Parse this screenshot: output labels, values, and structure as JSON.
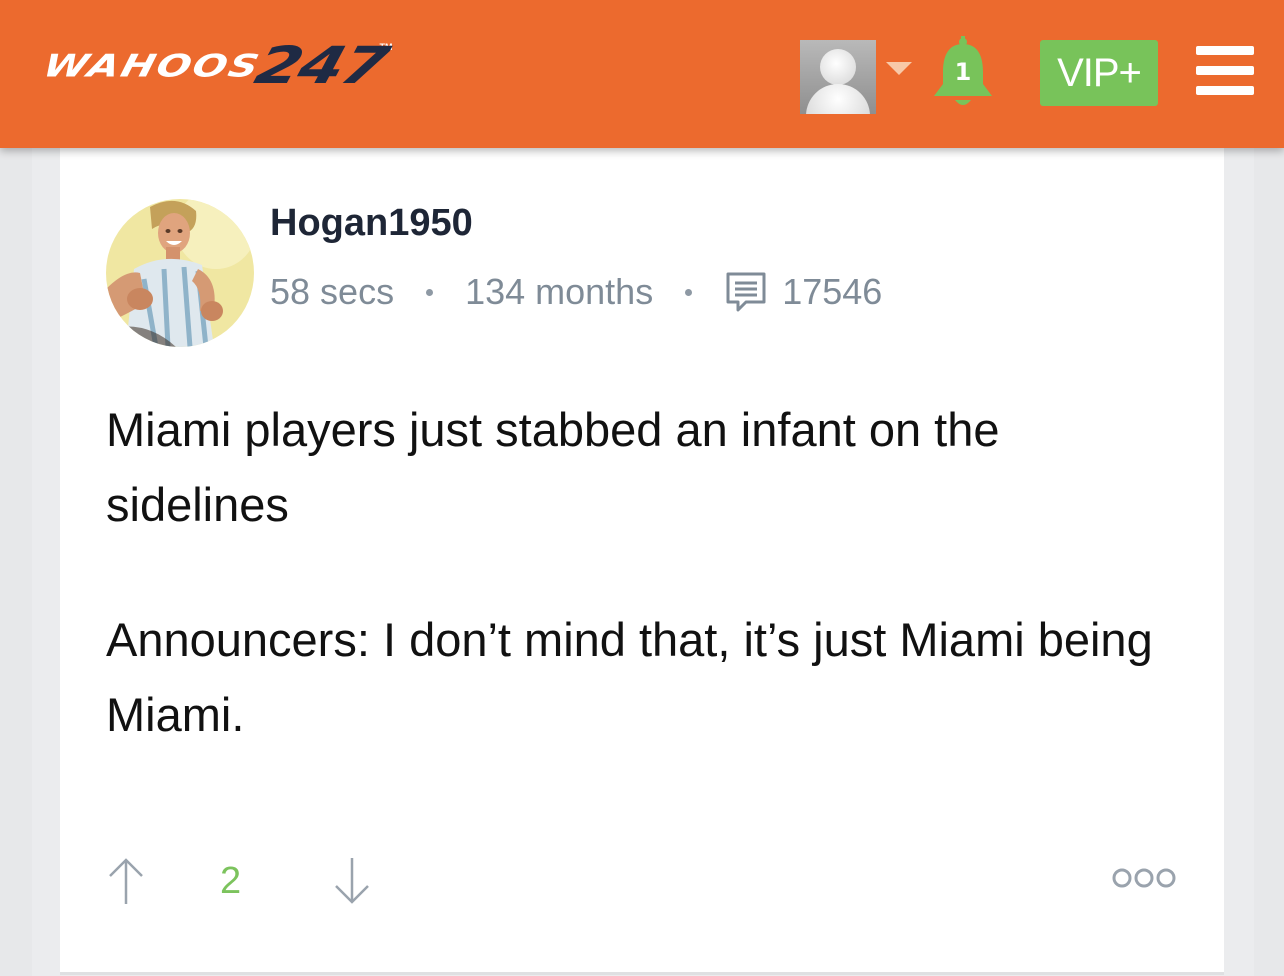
{
  "header": {
    "logo_word": "WAHOOS",
    "logo_number": "247",
    "logo_tm": "TM",
    "notifications_count": "1",
    "vip_label": "VIP+",
    "icons": [
      "user-avatar-icon",
      "dropdown-caret-icon",
      "bell-icon",
      "hamburger-menu-icon"
    ],
    "colors": {
      "bar": "#ec6a2e",
      "vip": "#78c35a",
      "bell": "#78c35a",
      "logo_number": "#1f2a44"
    }
  },
  "post": {
    "username": "Hogan1950",
    "time_ago": "58 secs",
    "member_for": "134 months",
    "post_count": "17546",
    "body": [
      "Miami players just stabbed an infant on the sidelines",
      "Announcers: I don’t mind that, it’s just Miami being Miami."
    ],
    "score": "2",
    "icons": [
      "message-icon",
      "upvote-arrow-icon",
      "downvote-arrow-icon",
      "more-options-icon"
    ],
    "colors": {
      "score": "#7cc35d",
      "meta": "#7f8b97"
    }
  }
}
